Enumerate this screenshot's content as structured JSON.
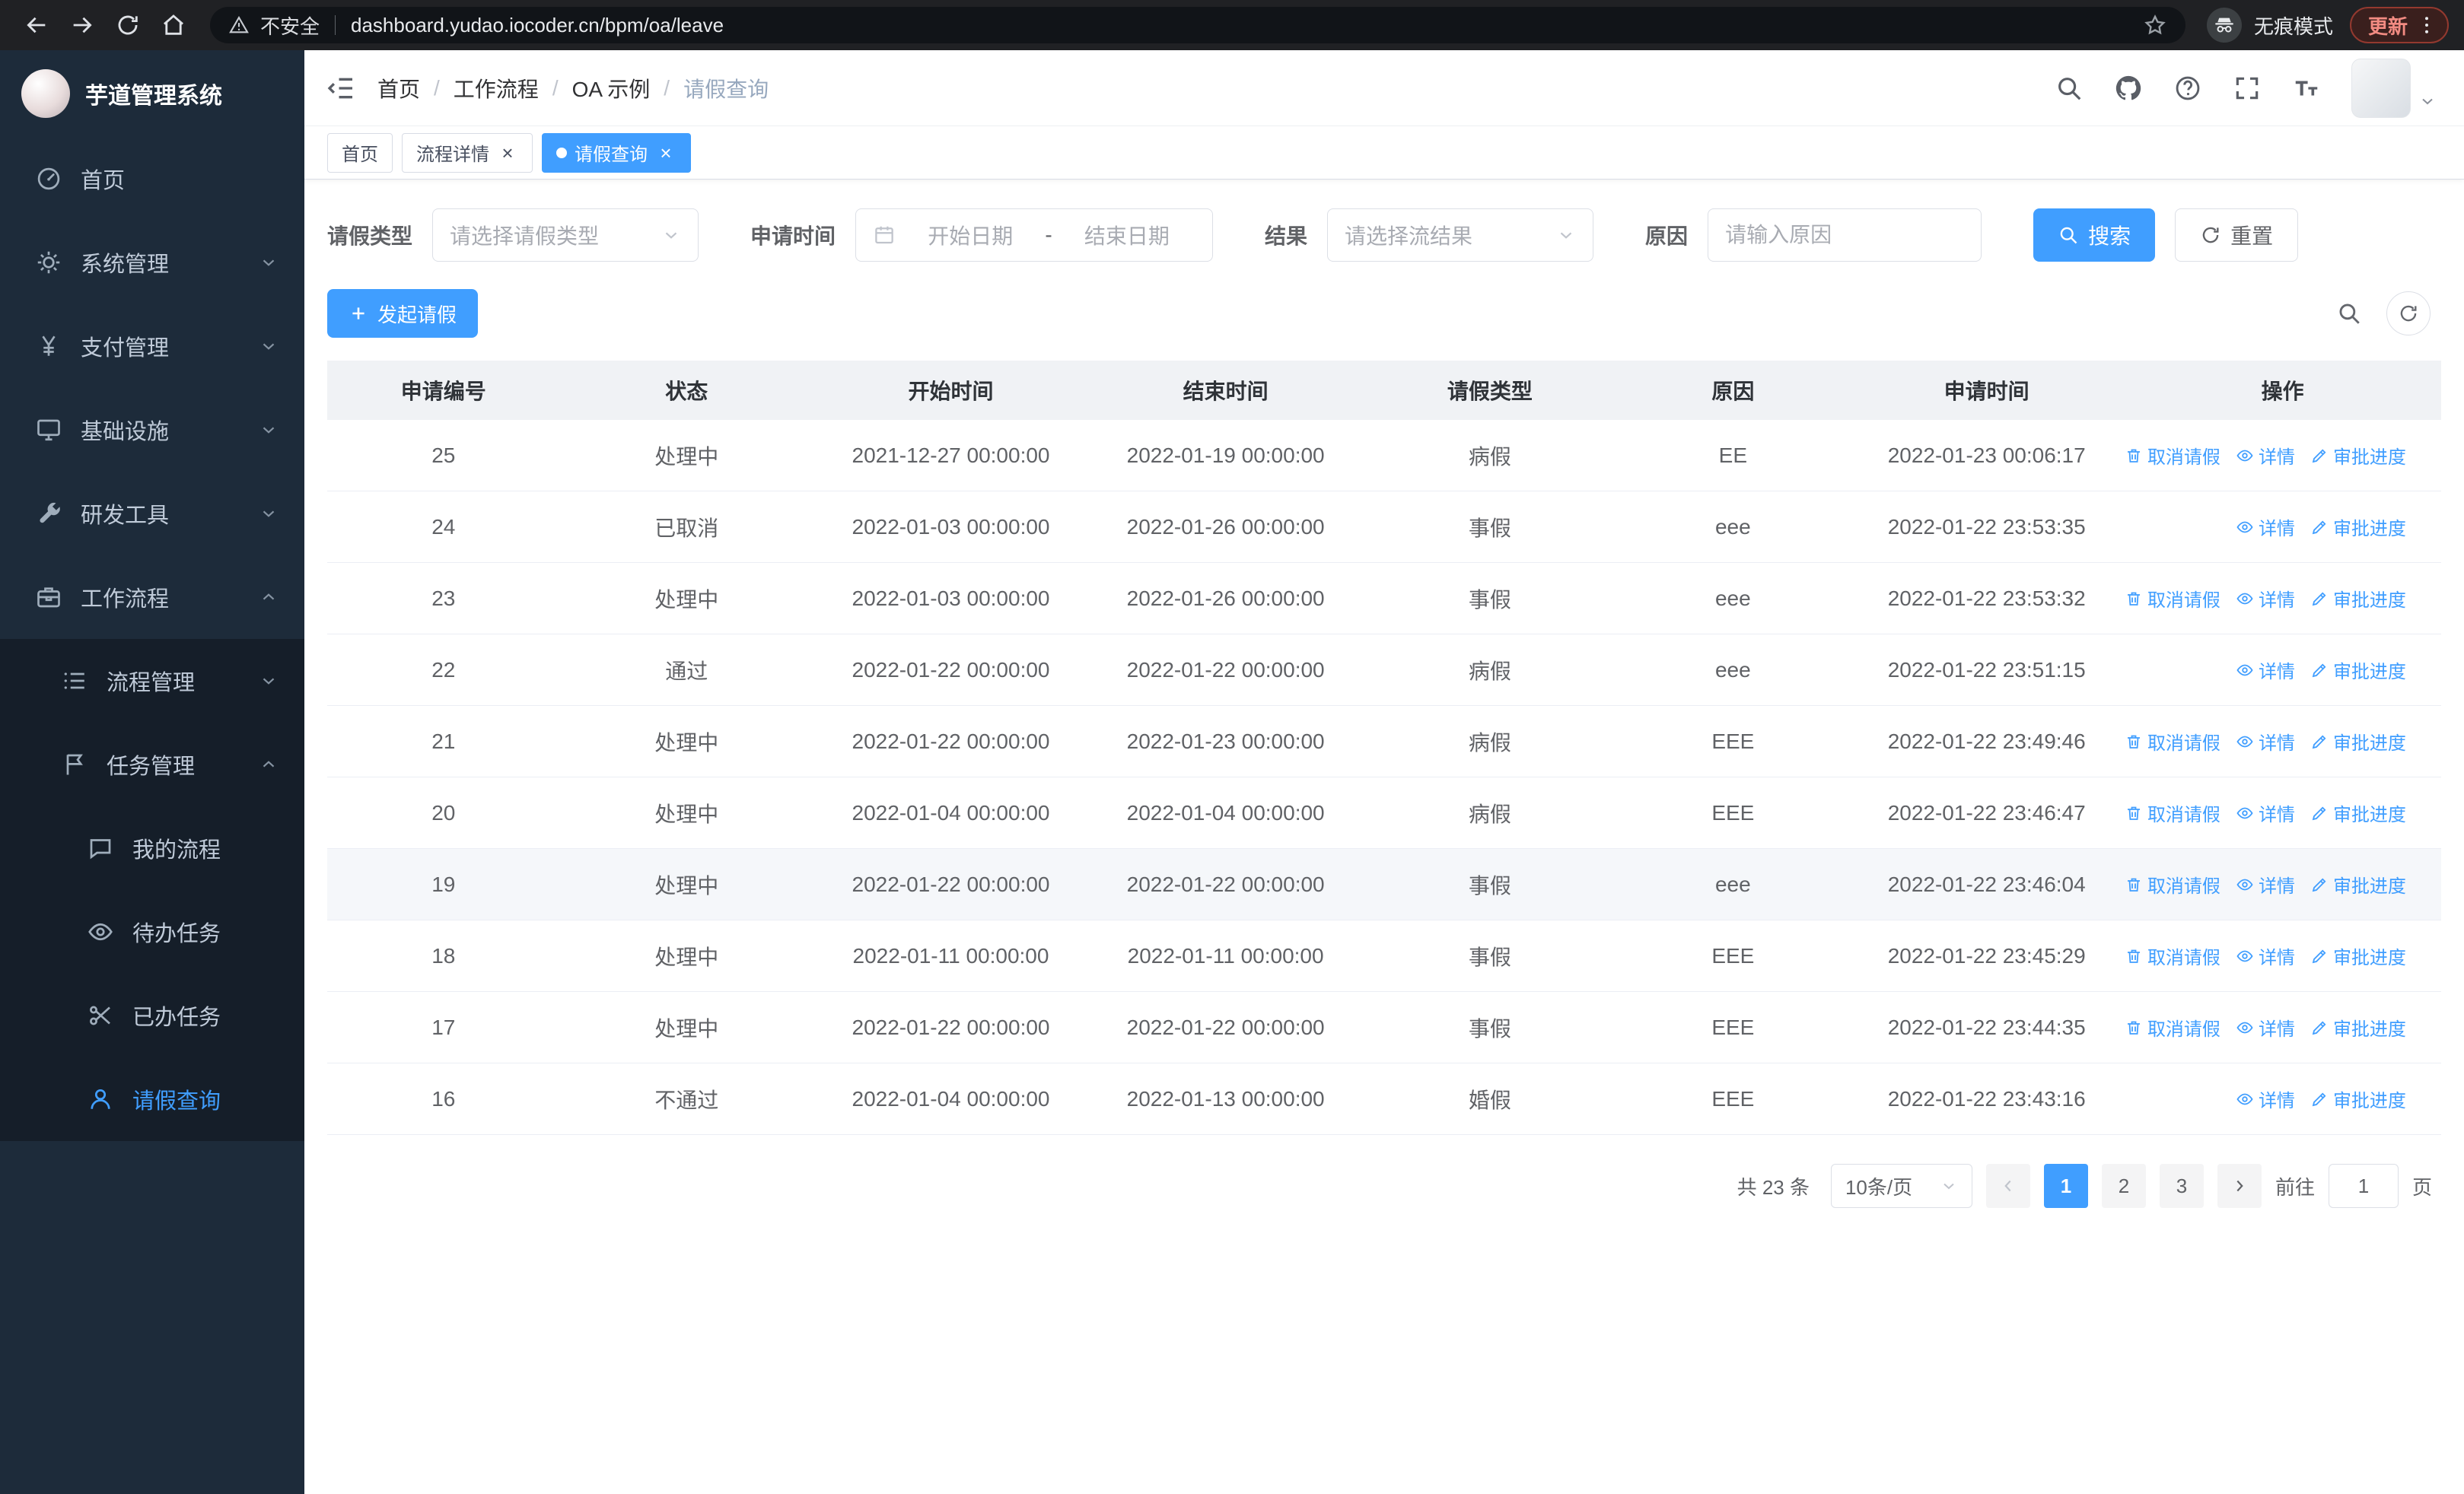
{
  "theme": {
    "accent": "#409eff",
    "sidebar_bg": "#1d2b3a",
    "sidebar_sub_bg": "#151e29"
  },
  "browser": {
    "security_label": "不安全",
    "url": "dashboard.yudao.iocoder.cn/bpm/oa/leave",
    "incognito_label": "无痕模式",
    "update_label": "更新"
  },
  "sidebar": {
    "title": "芋道管理系统",
    "menu": [
      {
        "key": "home",
        "label": "首页",
        "icon": "dashboard-icon",
        "type": "item"
      },
      {
        "key": "system",
        "label": "系统管理",
        "icon": "gear-icon",
        "type": "submenu",
        "state": "collapsed"
      },
      {
        "key": "payment",
        "label": "支付管理",
        "icon": "yen-icon",
        "type": "submenu",
        "state": "collapsed"
      },
      {
        "key": "infra",
        "label": "基础设施",
        "icon": "infra-icon",
        "type": "submenu",
        "state": "collapsed"
      },
      {
        "key": "devtools",
        "label": "研发工具",
        "icon": "wrench-icon",
        "type": "submenu",
        "state": "collapsed"
      },
      {
        "key": "workflow",
        "label": "工作流程",
        "icon": "workflow-icon",
        "type": "submenu",
        "state": "expanded",
        "children": [
          {
            "key": "process-mgmt",
            "label": "流程管理",
            "icon": "list-icon",
            "type": "submenu",
            "state": "collapsed"
          },
          {
            "key": "task-mgmt",
            "label": "任务管理",
            "icon": "flag-icon",
            "type": "submenu",
            "state": "expanded",
            "children": [
              {
                "key": "my-process",
                "label": "我的流程",
                "icon": "chat-icon",
                "type": "item"
              },
              {
                "key": "todo-task",
                "label": "待办任务",
                "icon": "eye-icon",
                "type": "item"
              },
              {
                "key": "done-task",
                "label": "已办任务",
                "icon": "scissors-icon",
                "type": "item"
              },
              {
                "key": "leave-query",
                "label": "请假查询",
                "icon": "user-icon",
                "type": "item",
                "active": true
              }
            ]
          }
        ]
      }
    ]
  },
  "header": {
    "breadcrumb": [
      "首页",
      "工作流程",
      "OA 示例",
      "请假查询"
    ]
  },
  "tabs": [
    {
      "label": "首页",
      "closable": false,
      "active": false
    },
    {
      "label": "流程详情",
      "closable": true,
      "active": false
    },
    {
      "label": "请假查询",
      "closable": true,
      "active": true
    }
  ],
  "filters": {
    "leave_type": {
      "label": "请假类型",
      "placeholder": "请选择请假类型"
    },
    "apply_time": {
      "label": "申请时间",
      "start_placeholder": "开始日期",
      "separator": "-",
      "end_placeholder": "结束日期"
    },
    "result": {
      "label": "结果",
      "placeholder": "请选择流结果"
    },
    "reason": {
      "label": "原因",
      "placeholder": "请输入原因"
    },
    "search_label": "搜索",
    "reset_label": "重置"
  },
  "toolbar": {
    "create_label": "发起请假"
  },
  "actions": {
    "cancel": {
      "label": "取消请假",
      "icon": "trash-icon"
    },
    "detail": {
      "label": "详情",
      "icon": "eye-icon"
    },
    "progress": {
      "label": "审批进度",
      "icon": "edit-icon"
    }
  },
  "table": {
    "headers": [
      "申请编号",
      "状态",
      "开始时间",
      "结束时间",
      "请假类型",
      "原因",
      "申请时间",
      "操作"
    ],
    "rows": [
      {
        "id": "25",
        "status": "处理中",
        "start": "2021-12-27 00:00:00",
        "end": "2022-01-19 00:00:00",
        "type": "病假",
        "reason": "EE",
        "apply_time": "2022-01-23 00:06:17",
        "actions": [
          "cancel",
          "detail",
          "progress"
        ],
        "highlighted": false
      },
      {
        "id": "24",
        "status": "已取消",
        "start": "2022-01-03 00:00:00",
        "end": "2022-01-26 00:00:00",
        "type": "事假",
        "reason": "eee",
        "apply_time": "2022-01-22 23:53:35",
        "actions": [
          "detail",
          "progress"
        ],
        "highlighted": false
      },
      {
        "id": "23",
        "status": "处理中",
        "start": "2022-01-03 00:00:00",
        "end": "2022-01-26 00:00:00",
        "type": "事假",
        "reason": "eee",
        "apply_time": "2022-01-22 23:53:32",
        "actions": [
          "cancel",
          "detail",
          "progress"
        ],
        "highlighted": false
      },
      {
        "id": "22",
        "status": "通过",
        "start": "2022-01-22 00:00:00",
        "end": "2022-01-22 00:00:00",
        "type": "病假",
        "reason": "eee",
        "apply_time": "2022-01-22 23:51:15",
        "actions": [
          "detail",
          "progress"
        ],
        "highlighted": false
      },
      {
        "id": "21",
        "status": "处理中",
        "start": "2022-01-22 00:00:00",
        "end": "2022-01-23 00:00:00",
        "type": "病假",
        "reason": "EEE",
        "apply_time": "2022-01-22 23:49:46",
        "actions": [
          "cancel",
          "detail",
          "progress"
        ],
        "highlighted": false
      },
      {
        "id": "20",
        "status": "处理中",
        "start": "2022-01-04 00:00:00",
        "end": "2022-01-04 00:00:00",
        "type": "病假",
        "reason": "EEE",
        "apply_time": "2022-01-22 23:46:47",
        "actions": [
          "cancel",
          "detail",
          "progress"
        ],
        "highlighted": false
      },
      {
        "id": "19",
        "status": "处理中",
        "start": "2022-01-22 00:00:00",
        "end": "2022-01-22 00:00:00",
        "type": "事假",
        "reason": "eee",
        "apply_time": "2022-01-22 23:46:04",
        "actions": [
          "cancel",
          "detail",
          "progress"
        ],
        "highlighted": true
      },
      {
        "id": "18",
        "status": "处理中",
        "start": "2022-01-11 00:00:00",
        "end": "2022-01-11 00:00:00",
        "type": "事假",
        "reason": "EEE",
        "apply_time": "2022-01-22 23:45:29",
        "actions": [
          "cancel",
          "detail",
          "progress"
        ],
        "highlighted": false
      },
      {
        "id": "17",
        "status": "处理中",
        "start": "2022-01-22 00:00:00",
        "end": "2022-01-22 00:00:00",
        "type": "事假",
        "reason": "EEE",
        "apply_time": "2022-01-22 23:44:35",
        "actions": [
          "cancel",
          "detail",
          "progress"
        ],
        "highlighted": false
      },
      {
        "id": "16",
        "status": "不通过",
        "start": "2022-01-04 00:00:00",
        "end": "2022-01-13 00:00:00",
        "type": "婚假",
        "reason": "EEE",
        "apply_time": "2022-01-22 23:43:16",
        "actions": [
          "detail",
          "progress"
        ],
        "highlighted": false
      }
    ]
  },
  "pagination": {
    "total_label": "共 23 条",
    "page_size_label": "10条/页",
    "pages": [
      "1",
      "2",
      "3"
    ],
    "current_page": "1",
    "goto_label": "前往",
    "goto_value": "1",
    "page_unit_label": "页"
  }
}
